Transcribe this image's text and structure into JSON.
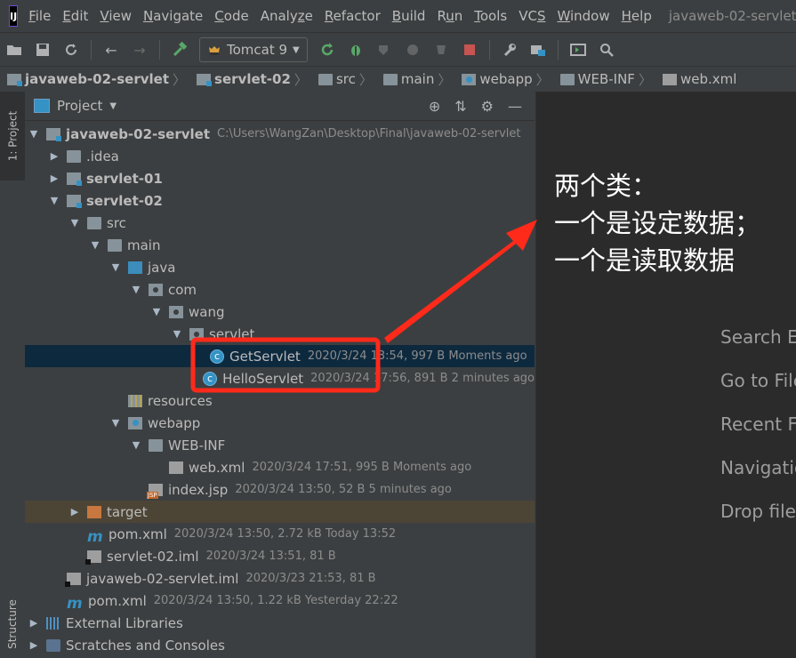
{
  "menubar": {
    "logo": "IJ",
    "items": [
      {
        "mn": "F",
        "rest": "ile"
      },
      {
        "mn": "E",
        "rest": "dit"
      },
      {
        "mn": "V",
        "rest": "iew"
      },
      {
        "mn": "N",
        "rest": "avigate"
      },
      {
        "mn": "C",
        "rest": "ode"
      },
      {
        "pre": "Analy",
        "mn": "z",
        "rest": "e"
      },
      {
        "mn": "R",
        "rest": "efactor"
      },
      {
        "mn": "B",
        "rest": "uild"
      },
      {
        "pre": "R",
        "mn": "u",
        "rest": "n"
      },
      {
        "mn": "T",
        "rest": "ools"
      },
      {
        "pre": "VC",
        "mn": "S",
        "rest": ""
      },
      {
        "mn": "W",
        "rest": "indow"
      },
      {
        "mn": "H",
        "rest": "elp"
      }
    ],
    "window_title": "javaweb-02-servlet"
  },
  "toolbar": {
    "run_config_label": "Tomcat 9"
  },
  "breadcrumb": [
    {
      "label": "javaweb-02-servlet",
      "bold": true,
      "icon": "module-folder-icon"
    },
    {
      "label": "servlet-02",
      "bold": true,
      "icon": "module-folder-icon"
    },
    {
      "label": "src",
      "icon": "folder-icon"
    },
    {
      "label": "main",
      "icon": "folder-icon"
    },
    {
      "label": "webapp",
      "icon": "web-folder-icon"
    },
    {
      "label": "WEB-INF",
      "icon": "folder-icon"
    },
    {
      "label": "web.xml",
      "icon": "xml-file-icon"
    }
  ],
  "side_stripe": {
    "project_tab": "1: Project",
    "structure_tab": "Structure"
  },
  "project_panel": {
    "title": "Project",
    "tree": [
      {
        "depth": 0,
        "arrow": "down",
        "icon": "module-folder-icon",
        "label": "javaweb-02-servlet",
        "bold": true,
        "meta": "C:\\Users\\WangZan\\Desktop\\Final\\javaweb-02-servlet"
      },
      {
        "depth": 1,
        "arrow": "right",
        "icon": "folder-icon",
        "label": ".idea"
      },
      {
        "depth": 1,
        "arrow": "right",
        "icon": "module-folder-icon",
        "label": "servlet-01",
        "bold": true
      },
      {
        "depth": 1,
        "arrow": "down",
        "icon": "module-folder-icon",
        "label": "servlet-02",
        "bold": true
      },
      {
        "depth": 2,
        "arrow": "down",
        "icon": "folder-icon",
        "label": "src"
      },
      {
        "depth": 3,
        "arrow": "down",
        "icon": "folder-icon",
        "label": "main"
      },
      {
        "depth": 4,
        "arrow": "down",
        "icon": "java-source-folder-icon",
        "label": "java"
      },
      {
        "depth": 5,
        "arrow": "down",
        "icon": "package-icon",
        "label": "com"
      },
      {
        "depth": 6,
        "arrow": "down",
        "icon": "package-icon",
        "label": "wang"
      },
      {
        "depth": 7,
        "arrow": "down",
        "icon": "package-icon",
        "label": "servlet"
      },
      {
        "depth": 8,
        "arrow": "",
        "icon": "java-class-icon",
        "label": "GetServlet",
        "meta": "2020/3/24 13:54, 997 B Moments ago",
        "selected": true
      },
      {
        "depth": 8,
        "arrow": "",
        "icon": "java-class-icon",
        "label": "HelloServlet",
        "meta": "2020/3/24 17:56, 891 B 2 minutes ago"
      },
      {
        "depth": 4,
        "arrow": "",
        "icon": "resources-folder-icon",
        "label": "resources"
      },
      {
        "depth": 4,
        "arrow": "down",
        "icon": "web-folder-icon",
        "label": "webapp"
      },
      {
        "depth": 5,
        "arrow": "down",
        "icon": "folder-icon",
        "label": "WEB-INF"
      },
      {
        "depth": 6,
        "arrow": "",
        "icon": "xml-file-icon",
        "label": "web.xml",
        "meta": "2020/3/24 17:51, 995 B Moments ago"
      },
      {
        "depth": 5,
        "arrow": "",
        "icon": "jsp-file-icon",
        "label": "index.jsp",
        "meta": "2020/3/24 13:50, 52 B 5 minutes ago"
      },
      {
        "depth": 2,
        "arrow": "right",
        "icon": "target-folder-icon",
        "label": "target",
        "excluded": true
      },
      {
        "depth": 2,
        "arrow": "",
        "icon": "maven-icon",
        "label": "pom.xml",
        "meta": "2020/3/24 13:50, 2.72 kB Today 13:52"
      },
      {
        "depth": 2,
        "arrow": "",
        "icon": "iml-file-icon",
        "label": "servlet-02.iml",
        "meta": "2020/3/24 13:51, 81 B"
      },
      {
        "depth": 1,
        "arrow": "",
        "icon": "iml-file-icon",
        "label": "javaweb-02-servlet.iml",
        "meta": "2020/3/23 21:53, 81 B"
      },
      {
        "depth": 1,
        "arrow": "",
        "icon": "maven-icon",
        "label": "pom.xml",
        "meta": "2020/3/24 13:50, 1.22 kB Yesterday 22:22"
      },
      {
        "depth": 0,
        "arrow": "right",
        "icon": "libraries-icon",
        "label": "External Libraries"
      },
      {
        "depth": 0,
        "arrow": "right",
        "icon": "scratches-icon",
        "label": "Scratches and Consoles"
      }
    ]
  },
  "annotation": {
    "lines": [
      "两个类：",
      "一个是设定数据；",
      "一个是读取数据"
    ],
    "color": "#ffffff",
    "arrow_color": "#ff2a1a",
    "box_color": "#ff2a1a"
  },
  "editor_hints": [
    "Search Ev",
    "Go to File",
    "Recent Fil",
    "Navigatio",
    "Drop files"
  ]
}
